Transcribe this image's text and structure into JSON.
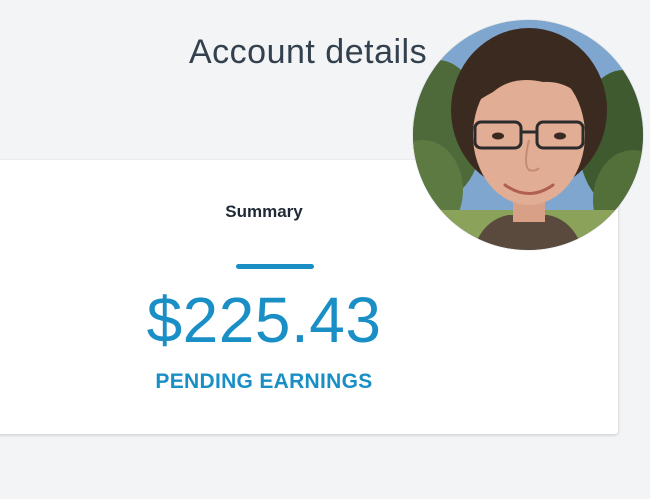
{
  "header": {
    "title": "Account details"
  },
  "profile": {
    "avatar_icon": "user-avatar-photo"
  },
  "summary": {
    "heading": "Summary",
    "amount": "$225.43",
    "label": "PENDING EARNINGS"
  },
  "colors": {
    "accent": "#1a8fc6",
    "background": "#f3f4f6",
    "card": "#ffffff",
    "title_text": "#33404d"
  }
}
